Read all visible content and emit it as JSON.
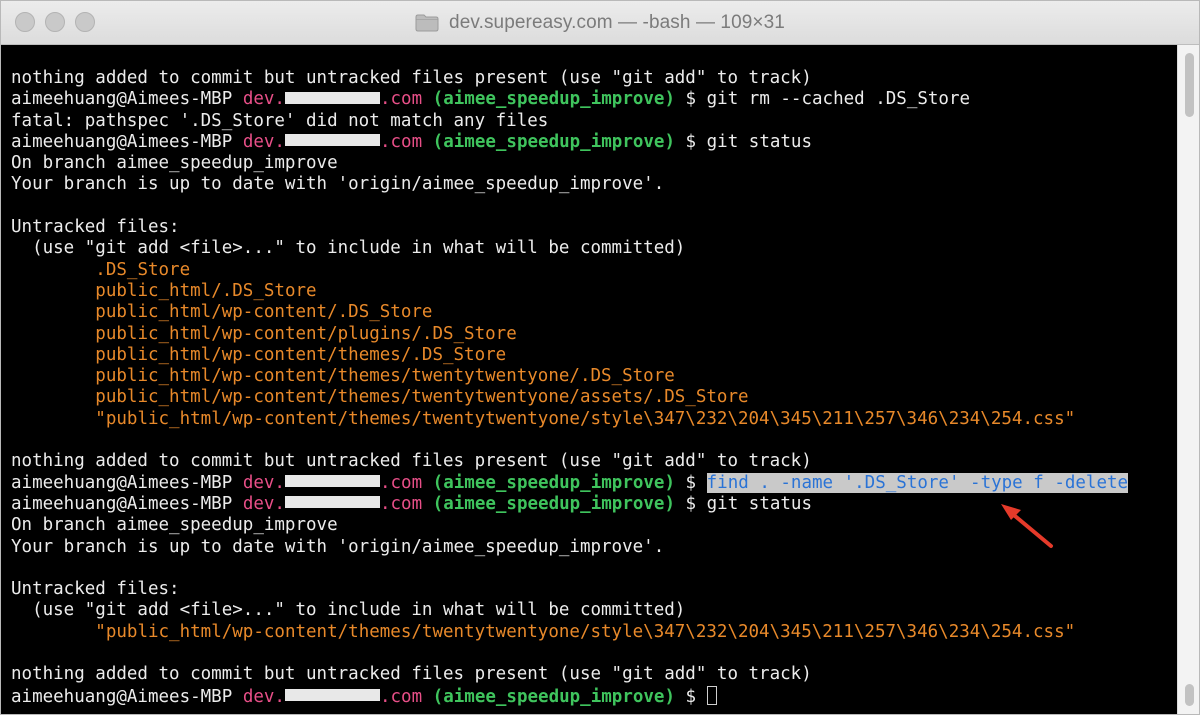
{
  "window": {
    "title": "dev.supereasy.com — -bash — 109×31"
  },
  "prompt": {
    "user_host": "aimeehuang@Aimees-MBP",
    "dir_prefix": "dev.",
    "dir_suffix": ".com",
    "branch": "(aimee_speedup_improve)",
    "symbol": "$"
  },
  "lines": {
    "l1": "nothing added to commit but untracked files present (use \"git add\" to track)",
    "cmd2": "git rm --cached .DS_Store",
    "l3": "fatal: pathspec '.DS_Store' did not match any files",
    "cmd4": "git status",
    "l5": "On branch aimee_speedup_improve",
    "l6": "Your branch is up to date with 'origin/aimee_speedup_improve'.",
    "l8": "Untracked files:",
    "l9": "  (use \"git add <file>...\" to include in what will be committed)",
    "f1": ".DS_Store",
    "f2": "public_html/.DS_Store",
    "f3": "public_html/wp-content/.DS_Store",
    "f4": "public_html/wp-content/plugins/.DS_Store",
    "f5": "public_html/wp-content/themes/.DS_Store",
    "f6": "public_html/wp-content/themes/twentytwentyone/.DS_Store",
    "f7": "public_html/wp-content/themes/twentytwentyone/assets/.DS_Store",
    "f8": "\"public_html/wp-content/themes/twentytwentyone/style\\347\\232\\204\\345\\211\\257\\346\\234\\254.css\"",
    "l19": "nothing added to commit but untracked files present (use \"git add\" to track)",
    "cmd20": "find . -name '.DS_Store' -type f -delete",
    "cmd21": "git status",
    "l22": "On branch aimee_speedup_improve",
    "l23": "Your branch is up to date with 'origin/aimee_speedup_improve'.",
    "l25": "Untracked files:",
    "l26": "  (use \"git add <file>...\" to include in what will be committed)",
    "f27": "\"public_html/wp-content/themes/twentytwentyone/style\\347\\232\\204\\345\\211\\257\\346\\234\\254.css\"",
    "l29": "nothing added to commit but untracked files present (use \"git add\" to track)"
  },
  "colors": {
    "host": "#e84f88",
    "branch": "#3fc45d",
    "untracked_file": "#e8892a",
    "selection_bg": "#c9c9c9",
    "selection_text": "#2a73d6",
    "annotation_arrow": "#e53a2a"
  },
  "icons": {
    "title_icon": "folder-icon",
    "annotation": "arrow-icon"
  }
}
